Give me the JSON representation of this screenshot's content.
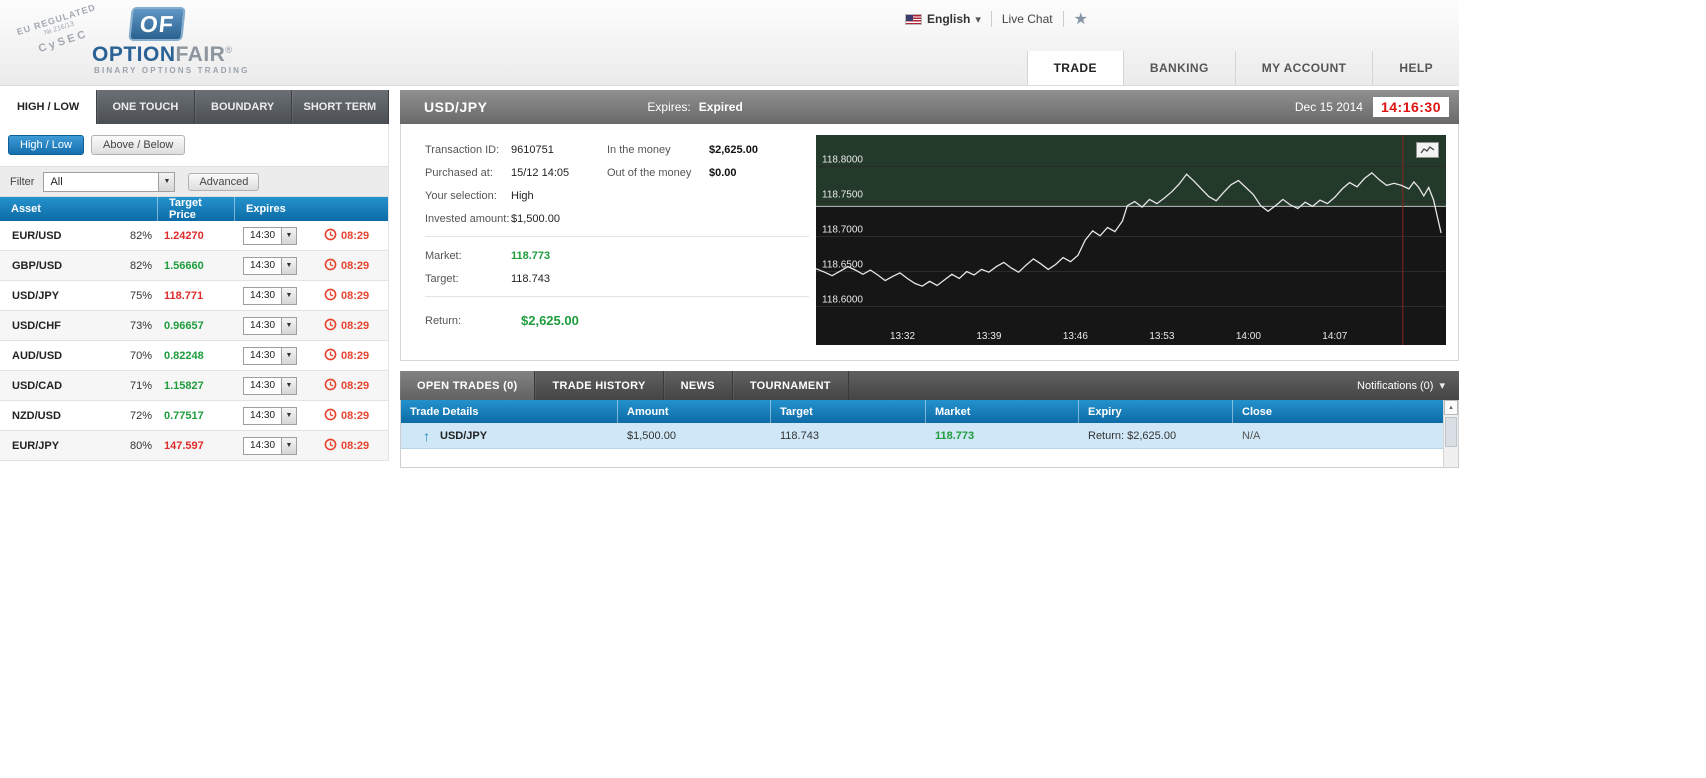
{
  "colors": {
    "accent_blue": "#1679b8",
    "green_up": "#1f9c3d",
    "red_down": "#e02b2b",
    "countdown_red": "#e8432e",
    "time_red": "#e01212"
  },
  "header": {
    "stamp": {
      "line1": "EU REGULATED",
      "line2": "№ 216/13",
      "line3": "CySEC"
    },
    "brand": {
      "mark": "OF",
      "name_primary": "OPTION",
      "name_secondary": "FAIR",
      "reg": "®",
      "tagline": "BINARY OPTIONS TRADING"
    },
    "language": {
      "label": "English"
    },
    "live_chat_label": "Live Chat",
    "nav_tabs": [
      {
        "label": "TRADE",
        "active": true
      },
      {
        "label": "BANKING",
        "active": false
      },
      {
        "label": "MY ACCOUNT",
        "active": false
      },
      {
        "label": "HELP",
        "active": false
      }
    ]
  },
  "left_panel": {
    "instrument_tabs": [
      {
        "label": "HIGH / LOW",
        "active": true
      },
      {
        "label": "ONE TOUCH",
        "active": false
      },
      {
        "label": "BOUNDARY",
        "active": false
      },
      {
        "label": "SHORT TERM",
        "active": false
      }
    ],
    "mode_buttons": [
      {
        "label": "High / Low",
        "active": true
      },
      {
        "label": "Above / Below",
        "active": false
      }
    ],
    "filter": {
      "label": "Filter",
      "value": "All",
      "advanced_label": "Advanced"
    },
    "asset_table": {
      "headers": [
        "Asset",
        "Target Price",
        "Expires"
      ],
      "rows": [
        {
          "asset": "EUR/USD",
          "payout": "82%",
          "price": "1.24270",
          "trend": "down",
          "expiry": "14:30",
          "countdown": "08:29"
        },
        {
          "asset": "GBP/USD",
          "payout": "82%",
          "price": "1.56660",
          "trend": "up",
          "expiry": "14:30",
          "countdown": "08:29"
        },
        {
          "asset": "USD/JPY",
          "payout": "75%",
          "price": "118.771",
          "trend": "down",
          "expiry": "14:30",
          "countdown": "08:29"
        },
        {
          "asset": "USD/CHF",
          "payout": "73%",
          "price": "0.96657",
          "trend": "up",
          "expiry": "14:30",
          "countdown": "08:29"
        },
        {
          "asset": "AUD/USD",
          "payout": "70%",
          "price": "0.82248",
          "trend": "up",
          "expiry": "14:30",
          "countdown": "08:29"
        },
        {
          "asset": "USD/CAD",
          "payout": "71%",
          "price": "1.15827",
          "trend": "up",
          "expiry": "14:30",
          "countdown": "08:29"
        },
        {
          "asset": "NZD/USD",
          "payout": "72%",
          "price": "0.77517",
          "trend": "up",
          "expiry": "14:30",
          "countdown": "08:29"
        },
        {
          "asset": "EUR/JPY",
          "payout": "80%",
          "price": "147.597",
          "trend": "down",
          "expiry": "14:30",
          "countdown": "08:29"
        }
      ]
    }
  },
  "trade_panel": {
    "title": "USD/JPY",
    "expires_label": "Expires:",
    "expires_value": "Expired",
    "date": "Dec 15 2014",
    "time": "14:16:30",
    "details": {
      "transaction_id_label": "Transaction ID:",
      "transaction_id": "9610751",
      "purchased_label": "Purchased at:",
      "purchased": "15/12 14:05",
      "selection_label": "Your selection:",
      "selection": "High",
      "invested_label": "Invested amount:",
      "invested": "$1,500.00",
      "in_money_label": "In the money",
      "in_money": "$2,625.00",
      "out_money_label": "Out of the money",
      "out_money": "$0.00",
      "market_label": "Market:",
      "market": "118.773",
      "target_label": "Target:",
      "target": "118.743",
      "return_label": "Return:",
      "return_value": "$2,625.00"
    }
  },
  "chart_data": {
    "type": "line",
    "title": "USD/JPY intraday price",
    "x_range": [
      0,
      51
    ],
    "y_range": [
      118.545,
      118.845
    ],
    "target_price": 118.743,
    "expiry_marker_m": 47.5,
    "grid": true,
    "colors": {
      "bg": "#161616",
      "band": "#233a2b",
      "line": "#e6e6e6",
      "marker": "#8a2323",
      "grid": "#2b2b2b",
      "target_line": "#bfbfbf"
    },
    "y_ticks": [
      {
        "value": 118.8,
        "label": "118.8000"
      },
      {
        "value": 118.75,
        "label": "118.7500"
      },
      {
        "value": 118.7,
        "label": "118.7000"
      },
      {
        "value": 118.65,
        "label": "118.6500"
      },
      {
        "value": 118.6,
        "label": "118.6000"
      }
    ],
    "x_ticks": [
      {
        "m": 7,
        "label": "13:32"
      },
      {
        "m": 14,
        "label": "13:39"
      },
      {
        "m": 21,
        "label": "13:46"
      },
      {
        "m": 28,
        "label": "13:53"
      },
      {
        "m": 35,
        "label": "14:00"
      },
      {
        "m": 42,
        "label": "14:07"
      }
    ],
    "series": [
      {
        "name": "USD/JPY",
        "points": [
          [
            0,
            118.654
          ],
          [
            0.7,
            118.649
          ],
          [
            1.3,
            118.644
          ],
          [
            2,
            118.651
          ],
          [
            2.6,
            118.657
          ],
          [
            3.2,
            118.652
          ],
          [
            3.8,
            118.646
          ],
          [
            4.4,
            118.652
          ],
          [
            5,
            118.645
          ],
          [
            5.6,
            118.637
          ],
          [
            6.2,
            118.643
          ],
          [
            6.8,
            118.648
          ],
          [
            7.4,
            118.64
          ],
          [
            8,
            118.633
          ],
          [
            8.6,
            118.629
          ],
          [
            9.2,
            118.636
          ],
          [
            9.8,
            118.63
          ],
          [
            10.4,
            118.638
          ],
          [
            11,
            118.646
          ],
          [
            11.6,
            118.64
          ],
          [
            12.2,
            118.65
          ],
          [
            12.8,
            118.645
          ],
          [
            13.4,
            118.653
          ],
          [
            14,
            118.649
          ],
          [
            14.6,
            118.657
          ],
          [
            15.2,
            118.663
          ],
          [
            15.8,
            118.655
          ],
          [
            16.4,
            118.649
          ],
          [
            17,
            118.659
          ],
          [
            17.6,
            118.668
          ],
          [
            18.2,
            118.661
          ],
          [
            18.8,
            118.653
          ],
          [
            19.4,
            118.66
          ],
          [
            20,
            118.67
          ],
          [
            20.6,
            118.664
          ],
          [
            21.2,
            118.673
          ],
          [
            21.8,
            118.695
          ],
          [
            22.4,
            118.708
          ],
          [
            23,
            118.701
          ],
          [
            23.6,
            118.713
          ],
          [
            24.2,
            118.707
          ],
          [
            24.8,
            118.722
          ],
          [
            25.2,
            118.744
          ],
          [
            25.8,
            118.75
          ],
          [
            26.4,
            118.742
          ],
          [
            27,
            118.753
          ],
          [
            27.6,
            118.747
          ],
          [
            28.2,
            118.755
          ],
          [
            28.8,
            118.764
          ],
          [
            29.4,
            118.775
          ],
          [
            30,
            118.789
          ],
          [
            30.6,
            118.779
          ],
          [
            31.2,
            118.768
          ],
          [
            31.8,
            118.757
          ],
          [
            32.4,
            118.751
          ],
          [
            33,
            118.763
          ],
          [
            33.6,
            118.774
          ],
          [
            34.2,
            118.78
          ],
          [
            34.8,
            118.77
          ],
          [
            35.4,
            118.76
          ],
          [
            36,
            118.744
          ],
          [
            36.6,
            118.736
          ],
          [
            37.2,
            118.744
          ],
          [
            37.8,
            118.753
          ],
          [
            38.4,
            118.745
          ],
          [
            39,
            118.74
          ],
          [
            39.6,
            118.749
          ],
          [
            40.2,
            118.743
          ],
          [
            40.8,
            118.752
          ],
          [
            41.4,
            118.747
          ],
          [
            42,
            118.756
          ],
          [
            42.6,
            118.768
          ],
          [
            43.2,
            118.777
          ],
          [
            43.8,
            118.771
          ],
          [
            44.4,
            118.783
          ],
          [
            45,
            118.791
          ],
          [
            45.6,
            118.781
          ],
          [
            46.2,
            118.773
          ],
          [
            46.8,
            118.776
          ],
          [
            47.4,
            118.773
          ],
          [
            48,
            118.768
          ],
          [
            48.4,
            118.778
          ],
          [
            48.8,
            118.77
          ],
          [
            49.2,
            118.758
          ],
          [
            49.6,
            118.77
          ],
          [
            50,
            118.752
          ],
          [
            50.3,
            118.728
          ],
          [
            50.6,
            118.705
          ]
        ]
      }
    ]
  },
  "bottom_panel": {
    "tabs": [
      {
        "label": "OPEN TRADES (0)",
        "active": true
      },
      {
        "label": "TRADE HISTORY",
        "active": false
      },
      {
        "label": "NEWS",
        "active": false
      },
      {
        "label": "TOURNAMENT",
        "active": false
      }
    ],
    "notifications_label": "Notifications (0)",
    "trades_table": {
      "headers": [
        "Trade Details",
        "Amount",
        "Target",
        "Market",
        "Expiry",
        "Close"
      ],
      "rows": [
        {
          "direction": "up",
          "asset": "USD/JPY",
          "amount": "$1,500.00",
          "target": "118.743",
          "market": "118.773",
          "expiry": "Return: $2,625.00",
          "close": "N/A"
        }
      ]
    }
  }
}
